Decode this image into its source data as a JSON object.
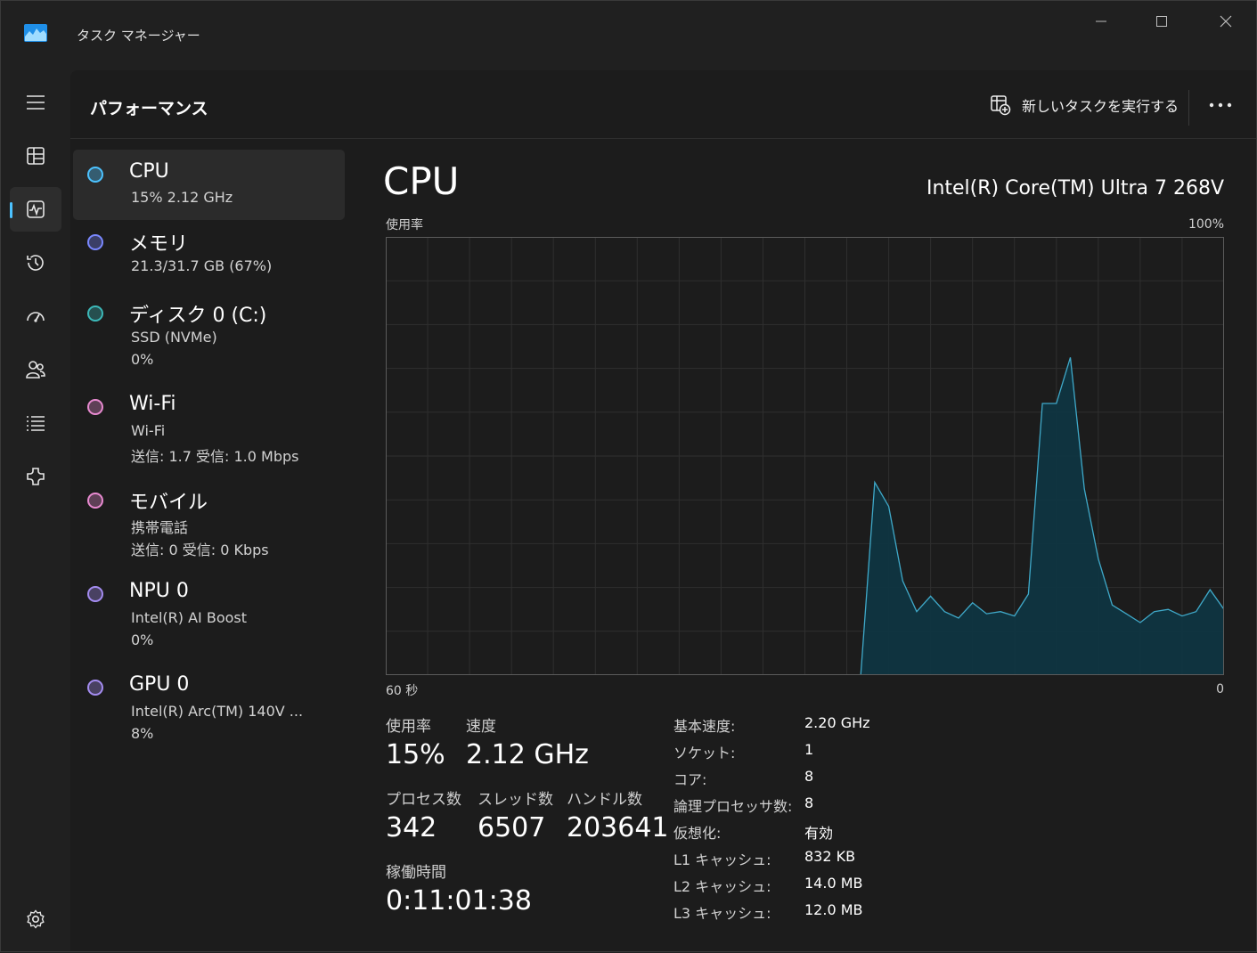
{
  "window": {
    "title": "タスク マネージャー"
  },
  "header": {
    "title": "パフォーマンス",
    "run_task": "新しいタスクを実行する"
  },
  "rail": [
    {
      "name": "hamburger-menu-icon"
    },
    {
      "name": "processes-icon"
    },
    {
      "name": "performance-icon"
    },
    {
      "name": "app-history-icon"
    },
    {
      "name": "startup-apps-icon"
    },
    {
      "name": "users-icon"
    },
    {
      "name": "details-icon"
    },
    {
      "name": "services-icon"
    },
    {
      "name": "settings-icon"
    }
  ],
  "devices": [
    {
      "name": "CPU",
      "line1": "15%  2.12 GHz",
      "line2": "",
      "color": "#4cc2ff"
    },
    {
      "name": "メモリ",
      "line1": "21.3/31.7 GB (67%)",
      "line2": "",
      "color": "#7a88ff"
    },
    {
      "name": "ディスク 0 (C:)",
      "line1": "SSD (NVMe)",
      "line2": "0%",
      "color": "#3cb8b8"
    },
    {
      "name": "Wi-Fi",
      "line1": "Wi-Fi",
      "line2": "送信: 1.7  受信: 1.0 Mbps",
      "color": "#e88ad0"
    },
    {
      "name": "モバイル",
      "line1": "携帯電話",
      "line2": "送信: 0  受信: 0 Kbps",
      "color": "#e88ad0"
    },
    {
      "name": "NPU 0",
      "line1": "Intel(R) AI Boost",
      "line2": "0%",
      "color": "#a48cf0"
    },
    {
      "name": "GPU 0",
      "line1": "Intel(R) Arc(TM) 140V ...",
      "line2": "8%",
      "color": "#a48cf0"
    }
  ],
  "detail": {
    "title": "CPU",
    "model": "Intel(R) Core(TM) Ultra 7 268V",
    "graph_label_top_left": "使用率",
    "graph_label_top_right": "100%",
    "graph_label_bottom_left": "60 秒",
    "graph_label_bottom_right": "0",
    "stats": {
      "usage_label": "使用率",
      "usage_value": "15%",
      "speed_label": "速度",
      "speed_value": "2.12 GHz",
      "processes_label": "プロセス数",
      "processes_value": "342",
      "threads_label": "スレッド数",
      "threads_value": "6507",
      "handles_label": "ハンドル数",
      "handles_value": "203641",
      "uptime_label": "稼働時間",
      "uptime_value": "0:11:01:38"
    },
    "specs": [
      {
        "key": "基本速度:",
        "value": "2.20 GHz"
      },
      {
        "key": "ソケット:",
        "value": "1"
      },
      {
        "key": "コア:",
        "value": "8"
      },
      {
        "key": "論理プロセッサ数:",
        "value": "8"
      },
      {
        "key": "仮想化:",
        "value": "有効"
      },
      {
        "key": "L1 キャッシュ:",
        "value": "832 KB"
      },
      {
        "key": "L2 キャッシュ:",
        "value": "14.0 MB"
      },
      {
        "key": "L3 キャッシュ:",
        "value": "12.0 MB"
      }
    ]
  },
  "chart_data": {
    "type": "area",
    "x": [
      60,
      59,
      58,
      57,
      56,
      55,
      54,
      53,
      52,
      51,
      50,
      49,
      48,
      47,
      46,
      45,
      44,
      43,
      42,
      41,
      40,
      39,
      38,
      37,
      36,
      35,
      34,
      33,
      32,
      31,
      30,
      29,
      28,
      27,
      26,
      25,
      24,
      23,
      22,
      21,
      20,
      19,
      18,
      17,
      16,
      15,
      14,
      13,
      12,
      11,
      10,
      9,
      8,
      7,
      6,
      5,
      4,
      3,
      2,
      1,
      0
    ],
    "series": [
      {
        "values": [
          0,
          0,
          0,
          0,
          0,
          0,
          0,
          0,
          0,
          0,
          0,
          0,
          0,
          0,
          0,
          0,
          0,
          0,
          0,
          0,
          0,
          0,
          0,
          0,
          0,
          0,
          0,
          0,
          0,
          0,
          0,
          0,
          0,
          0,
          0,
          44,
          38.5,
          21.5,
          14.5,
          18,
          14.5,
          13,
          16.5,
          14,
          14.5,
          13.5,
          18.5,
          62,
          62,
          72.5,
          42.5,
          26.5,
          16,
          14,
          12,
          14.5,
          15,
          13.5,
          14.5,
          19.5,
          15
        ]
      }
    ],
    "ylim": [
      0,
      100
    ],
    "grid": true,
    "fill_color": "#0f3541",
    "line_color": "#3fa9c9"
  }
}
